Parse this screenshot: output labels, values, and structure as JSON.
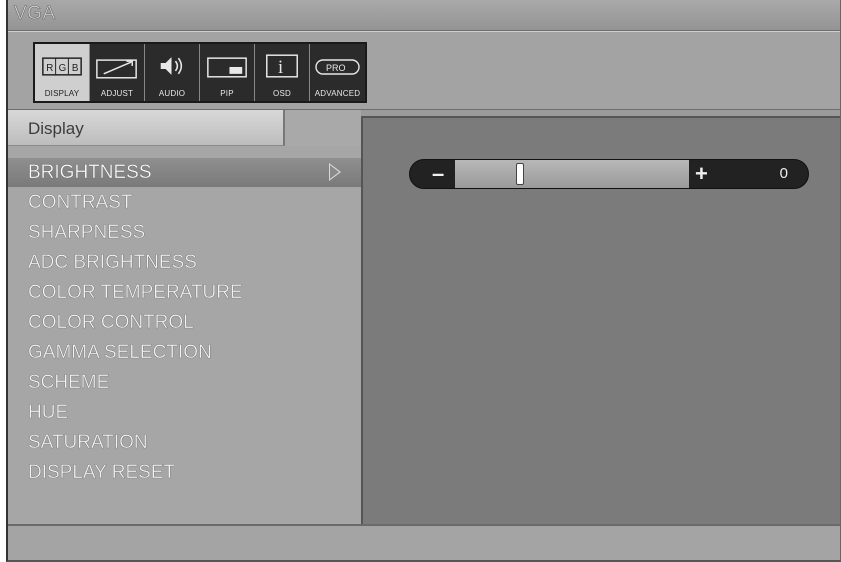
{
  "window": {
    "title": "VGA"
  },
  "toolbar": {
    "buttons": [
      {
        "label": "DISPLAY",
        "icon": "rgb-icon",
        "glyph": "RGB"
      },
      {
        "label": "ADJUST",
        "icon": "adjust-icon"
      },
      {
        "label": "AUDIO",
        "icon": "speaker-icon"
      },
      {
        "label": "PIP",
        "icon": "pip-icon"
      },
      {
        "label": "OSD",
        "icon": "info-icon",
        "glyph": "i"
      },
      {
        "label": "ADVANCED",
        "icon": "pro-icon",
        "glyph": "PRO"
      }
    ],
    "active_index": 0
  },
  "section": {
    "title": "Display"
  },
  "menu": {
    "items": [
      "BRIGHTNESS",
      "CONTRAST",
      "SHARPNESS",
      "ADC BRIGHTNESS",
      "COLOR TEMPERATURE",
      "COLOR CONTROL",
      "GAMMA SELECTION",
      "SCHEME",
      "HUE",
      "SATURATION",
      "DISPLAY RESET"
    ],
    "selected_index": 0
  },
  "slider": {
    "minus_label": "–",
    "plus_label": "+",
    "value_text": "0",
    "position_fraction": 0.27
  },
  "colors": {
    "osd_background": "#9a9a9a",
    "content_panel": "#7b7b7b",
    "selected_row": "#828282"
  }
}
